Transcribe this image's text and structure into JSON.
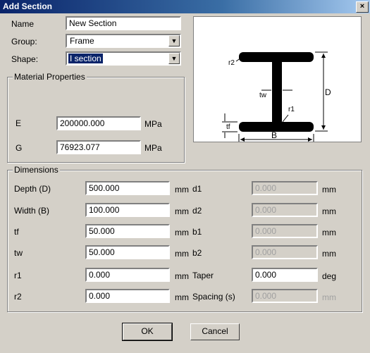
{
  "window": {
    "title": "Add Section",
    "close_glyph": "×"
  },
  "name": {
    "label": "Name",
    "value": "New Section"
  },
  "group": {
    "label": "Group:",
    "value": "Frame"
  },
  "shape": {
    "label": "Shape:",
    "value": "I section"
  },
  "material": {
    "title": "Material Properties",
    "E": {
      "label": "E",
      "value": "200000.000",
      "unit": "MPa"
    },
    "G": {
      "label": "G",
      "value": "76923.077",
      "unit": "MPa"
    }
  },
  "diagram": {
    "r2": "r2",
    "tw": "tw",
    "r1": "r1",
    "D": "D",
    "tf": "tf",
    "B": "B"
  },
  "dimensions": {
    "title": "Dimensions",
    "left": [
      {
        "label": "Depth (D)",
        "value": "500.000",
        "unit": "mm"
      },
      {
        "label": "Width (B)",
        "value": "100.000",
        "unit": "mm"
      },
      {
        "label": "tf",
        "value": "50.000",
        "unit": "mm"
      },
      {
        "label": "tw",
        "value": "50.000",
        "unit": "mm"
      },
      {
        "label": "r1",
        "value": "0.000",
        "unit": "mm"
      },
      {
        "label": "r2",
        "value": "0.000",
        "unit": "mm"
      }
    ],
    "right": [
      {
        "label": "d1",
        "value": "0.000",
        "unit": "mm",
        "enabled": false
      },
      {
        "label": "d2",
        "value": "0.000",
        "unit": "mm",
        "enabled": false
      },
      {
        "label": "b1",
        "value": "0.000",
        "unit": "mm",
        "enabled": false
      },
      {
        "label": "b2",
        "value": "0.000",
        "unit": "mm",
        "enabled": false
      },
      {
        "label": "Taper",
        "value": "0.000",
        "unit": "deg",
        "enabled": true
      },
      {
        "label": "Spacing (s)",
        "value": "0.000",
        "unit": "mm",
        "enabled": false
      }
    ]
  },
  "buttons": {
    "ok": "OK",
    "cancel": "Cancel"
  }
}
